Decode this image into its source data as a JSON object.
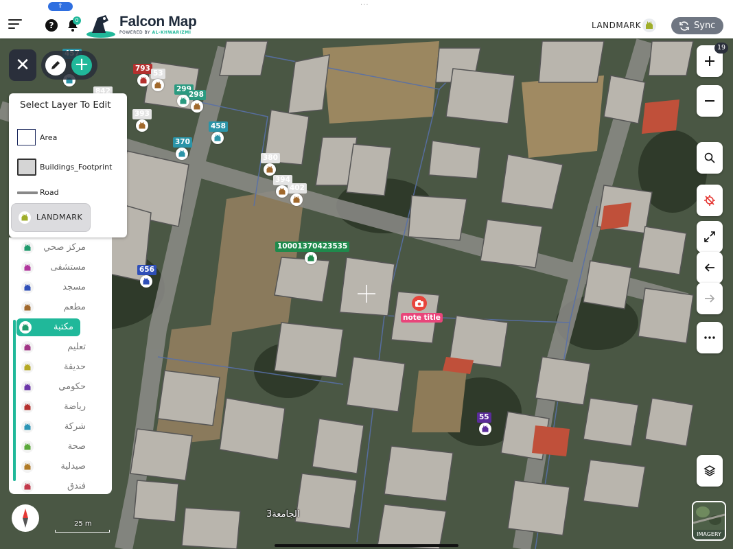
{
  "app": {
    "name": "Falcon Map",
    "powered_by_prefix": "POWERED BY",
    "powered_by_brand": "AL-KHWARIZMI",
    "notification_count": "0",
    "active_layer": "LANDMARK",
    "sync_label": "Sync"
  },
  "layer_panel": {
    "title": "Select Layer To Edit",
    "layers": [
      {
        "label": "Area",
        "swatch": "area"
      },
      {
        "label": "Buildings_Footprint",
        "swatch": "buildings"
      },
      {
        "label": "Road",
        "swatch": "road"
      },
      {
        "label": "LANDMARK",
        "swatch": "landmark-icon",
        "selected": true
      }
    ]
  },
  "categories": [
    {
      "label": "مركز صحي",
      "color": "#1f9a6c"
    },
    {
      "label": "مستشفى",
      "color": "#b0359c"
    },
    {
      "label": "مسجد",
      "color": "#2f4fb8"
    },
    {
      "label": "مطعم",
      "color": "#a0682c"
    },
    {
      "label": "مكتبة",
      "color": "#1f9a6c",
      "active": true
    },
    {
      "label": "تعليم",
      "color": "#a03484"
    },
    {
      "label": "حديقة",
      "color": "#b5a824"
    },
    {
      "label": "حكومي",
      "color": "#6b36a8"
    },
    {
      "label": "رياضة",
      "color": "#b4302e"
    },
    {
      "label": "شركة",
      "color": "#2b94b5"
    },
    {
      "label": "صحة",
      "color": "#5aa83a"
    },
    {
      "label": "صيدلية",
      "color": "#b07a26"
    },
    {
      "label": "فندق",
      "color": "#c2384a"
    }
  ],
  "markers": [
    {
      "label": "457",
      "color": "#2b94a8"
    },
    {
      "label": "793",
      "color": "#b4302e"
    },
    {
      "label": "53",
      "color": "#d8d8d8"
    },
    {
      "label": "842",
      "color": "#d8d8d8"
    },
    {
      "label": "299",
      "color": "#2b9a80"
    },
    {
      "label": "298",
      "color": "#2b9a80"
    },
    {
      "label": "393",
      "color": "#d8d8d8"
    },
    {
      "label": "458",
      "color": "#2b94a8"
    },
    {
      "label": "370",
      "color": "#2b94a8"
    },
    {
      "label": "380",
      "color": "#d8d8d8"
    },
    {
      "label": "394",
      "color": "#d8d8d8"
    },
    {
      "label": "402",
      "color": "#d8d8d8"
    },
    {
      "label": "656",
      "color": "#2f4fb8"
    },
    {
      "label": "10001370423535",
      "color": "#1f8a4c"
    },
    {
      "label": "55",
      "color": "#5a2c9a"
    }
  ],
  "note": {
    "label": "note title"
  },
  "map_labels": {
    "street": "الجامعة3"
  },
  "map_controls": {
    "zoom_level": "19",
    "scale_label": "25 m",
    "imagery_label": "IMAGERY"
  },
  "colors": {
    "accent": "#20b89a",
    "dark": "#2a2f3b",
    "sync": "#6f7682"
  }
}
